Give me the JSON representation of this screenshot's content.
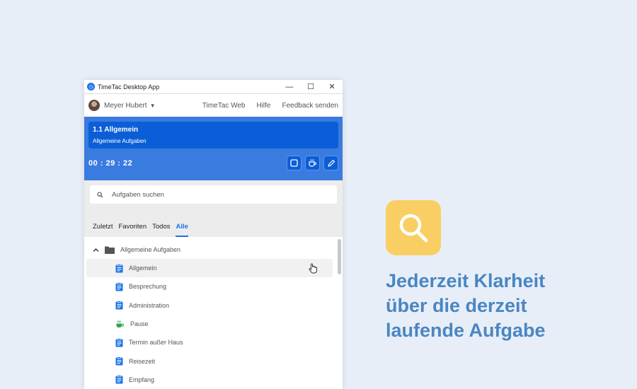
{
  "window": {
    "title": "TimeTac Desktop App",
    "controls": {
      "minimize": "—",
      "maximize": "☐",
      "close": "✕"
    }
  },
  "menubar": {
    "user_name": "Meyer Hubert",
    "links": [
      "TimeTac Web",
      "Hilfe",
      "Feedback senden"
    ]
  },
  "current_task": {
    "title": "1.1 Allgemein",
    "subtitle": "Allgemeine Aufgaben",
    "timer": "00 : 29 : 22"
  },
  "search": {
    "placeholder": "Aufgaben suchen"
  },
  "tabs": [
    {
      "label": "Zuletzt",
      "active": false
    },
    {
      "label": "Favoriten",
      "active": false
    },
    {
      "label": "Todos",
      "active": false
    },
    {
      "label": "Alle",
      "active": true
    }
  ],
  "task_list": {
    "group": "Allgemeine Aufgaben",
    "items": [
      {
        "label": "Allgemein",
        "icon": "clipboard-icon"
      },
      {
        "label": "Besprechung",
        "icon": "clipboard-icon"
      },
      {
        "label": "Administration",
        "icon": "clipboard-icon"
      },
      {
        "label": "Pause",
        "icon": "coffee-icon"
      },
      {
        "label": "Termin außer Haus",
        "icon": "clipboard-icon"
      },
      {
        "label": "Reisezeit",
        "icon": "clipboard-icon"
      },
      {
        "label": "Empfang",
        "icon": "clipboard-icon"
      }
    ]
  },
  "promo": {
    "headline_lines": [
      "Jederzeit Klarheit",
      "über die derzeit",
      "laufende Aufgabe"
    ]
  },
  "colors": {
    "accent": "#1a73e8",
    "panel_blue": "#3a7be0",
    "task_blue": "#0b5ed7",
    "promo_yellow": "#f9cf63",
    "headline": "#4a86c2",
    "pause_green": "#2ea44f"
  }
}
